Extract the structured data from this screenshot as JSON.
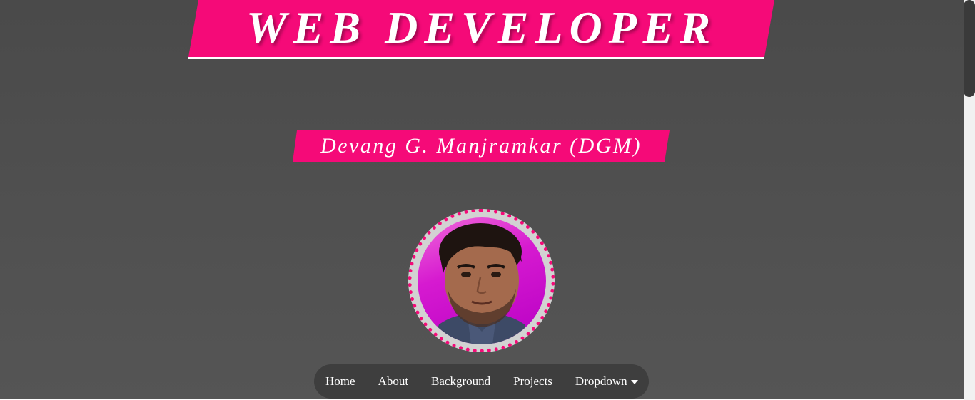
{
  "header": {
    "title": "WEB DEVELOPER",
    "subtitle": "Devang G. Manjramkar (DGM)"
  },
  "profile": {
    "photo_icon": "person-portrait"
  },
  "nav": {
    "items": [
      {
        "label": "Home"
      },
      {
        "label": "About"
      },
      {
        "label": "Background"
      },
      {
        "label": "Projects"
      },
      {
        "label": "Dropdown",
        "icon": "caret-down-icon"
      }
    ]
  },
  "colors": {
    "accent": "#f50a78",
    "background": "#4f4f4f",
    "navbar": "#3e3e3e"
  }
}
